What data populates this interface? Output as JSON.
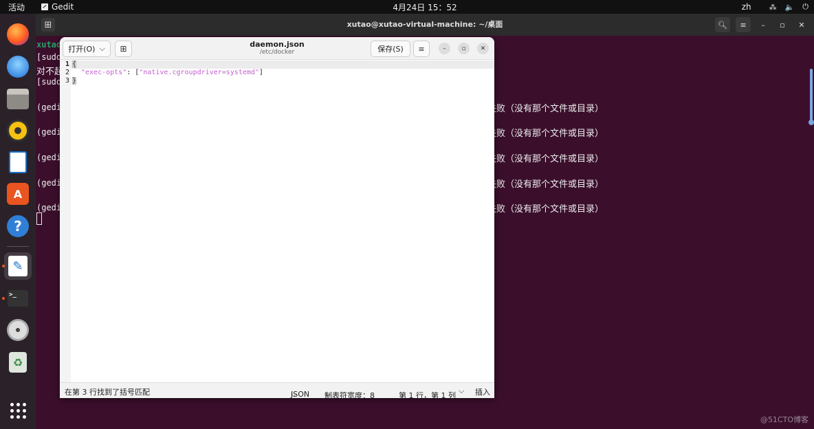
{
  "topbar": {
    "activities": "活动",
    "app_name": "Gedit",
    "clock": "4月24日  15：52",
    "lang": "zh",
    "network_icon": "network-icon",
    "volume_icon": "volume-icon",
    "power_icon": "power-icon"
  },
  "dock": {
    "items": [
      {
        "name": "firefox",
        "icon": "firefox-icon"
      },
      {
        "name": "thunderbird",
        "icon": "thunderbird-icon"
      },
      {
        "name": "files",
        "icon": "files-icon"
      },
      {
        "name": "rhythmbox",
        "icon": "rhythmbox-icon"
      },
      {
        "name": "writer",
        "icon": "writer-icon"
      },
      {
        "name": "software",
        "icon": "software-store-icon"
      },
      {
        "name": "help",
        "icon": "help-icon",
        "glyph": "?"
      },
      {
        "name": "gedit",
        "icon": "gedit-icon",
        "glyph": "✎"
      },
      {
        "name": "terminal",
        "icon": "terminal-icon",
        "glyph": ">_"
      },
      {
        "name": "disc",
        "icon": "disc-icon"
      },
      {
        "name": "trash",
        "icon": "trash-icon",
        "glyph": "♻"
      }
    ],
    "store_glyph": "A",
    "apps_icon": "show-apps-icon"
  },
  "terminal": {
    "title": "xutao@xutao-virtual-machine: ~/桌面",
    "lines": [
      "xutao@",
      "[sudo]",
      "对不起",
      "[sudo]",
      "",
      "(gedit",
      "",
      "(gedit",
      "",
      "(gedit",
      "",
      "(gedit",
      "",
      "(gedit"
    ],
    "right_fragments": [
      "失败（没有那个文件或目录）",
      "失败（没有那个文件或目录）",
      "失败（没有那个文件或目录）",
      "失败（没有那个文件或目录）",
      "失败（没有那个文件或目录）"
    ]
  },
  "gedit": {
    "open_label": "打开(O)",
    "filename": "daemon.json",
    "path": "/etc/docker",
    "save_label": "保存(S)",
    "lines": [
      {
        "num": "1",
        "text": "{"
      },
      {
        "num": "2",
        "key": "\"exec-opts\"",
        "sep": ": [",
        "value": "\"native.cgroupdriver=systemd\"",
        "end": "]"
      },
      {
        "num": "3",
        "text": "}"
      }
    ],
    "status": {
      "message": "在第 3 行找到了括号匹配",
      "language": "JSON",
      "tab_width": "制表符宽度：8",
      "position": "第 1 行，第 1 列",
      "insert_mode": "插入"
    }
  },
  "watermark": "@51CTO博客"
}
